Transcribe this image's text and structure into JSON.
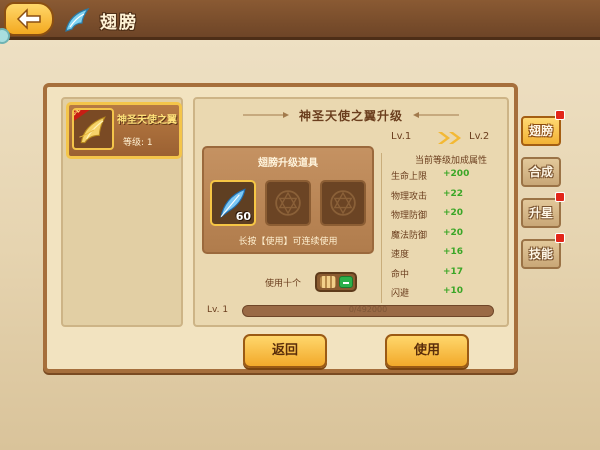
{
  "header": {
    "title": "翅膀",
    "back_icon": "back-arrow-icon",
    "title_icon": "wing-icon"
  },
  "wing_card": {
    "badge": "已装备",
    "name": "神圣天使之翼",
    "level_text": "等级:  1"
  },
  "upgrade": {
    "title": "神圣天使之翼升级",
    "item_box_title": "翅膀升级道具",
    "item_count": "60",
    "hold_hint": "长按【使用】可连续使用",
    "use_ten_label": "使用十个",
    "use_ten_on": true
  },
  "level_compare": {
    "current": "Lv.1",
    "next": "Lv.2"
  },
  "attributes": {
    "header": "当前等级加成属性",
    "rows": [
      {
        "name": "生命上限",
        "value": "+200"
      },
      {
        "name": "物理攻击",
        "value": "+22"
      },
      {
        "name": "物理防御",
        "value": "+20"
      },
      {
        "name": "魔法防御",
        "value": "+20"
      },
      {
        "name": "速度",
        "value": "+16"
      },
      {
        "name": "命中",
        "value": "+17"
      },
      {
        "name": "闪避",
        "value": "+10"
      }
    ]
  },
  "exp": {
    "label": "Lv. 1",
    "text": "0/492000",
    "fraction": 0.0
  },
  "buttons": {
    "return_label": "返回",
    "use_label": "使用"
  },
  "tabs": [
    {
      "label": "翅膀",
      "active": true,
      "notify": true
    },
    {
      "label": "合成",
      "active": false,
      "notify": false
    },
    {
      "label": "升星",
      "active": false,
      "notify": true
    },
    {
      "label": "技能",
      "active": false,
      "notify": true
    }
  ],
  "colors": {
    "accent": "#f2b234",
    "bonus_green": "#3aa626",
    "panel": "#f2e3c0",
    "notify": "#e2261a"
  }
}
